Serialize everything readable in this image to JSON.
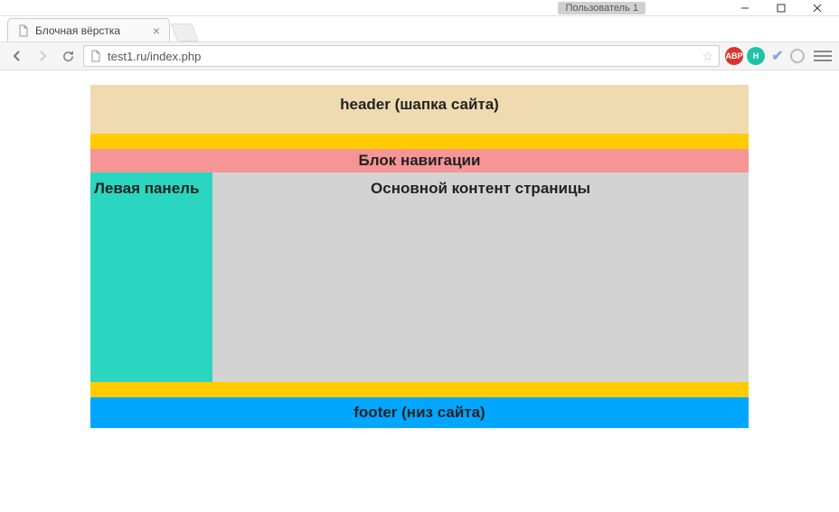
{
  "os": {
    "profile_label": "Пользователь 1"
  },
  "tab": {
    "title": "Блочная вёрстка"
  },
  "urlbar": {
    "url": "test1.ru/index.php"
  },
  "page": {
    "header_text": "header (шапка сайта)",
    "nav_text": "Блок навигации",
    "left_panel_text": "Левая панель",
    "main_text": "Основной контент страницы",
    "footer_text": "footer (низ сайта)"
  },
  "colors": {
    "header_bg": "#f0dab0",
    "strip_bg": "#ffcc00",
    "nav_bg": "#f59595",
    "left_bg": "#2bd6c0",
    "main_bg": "#d3d3d3",
    "footer_bg": "#00a6ff"
  }
}
